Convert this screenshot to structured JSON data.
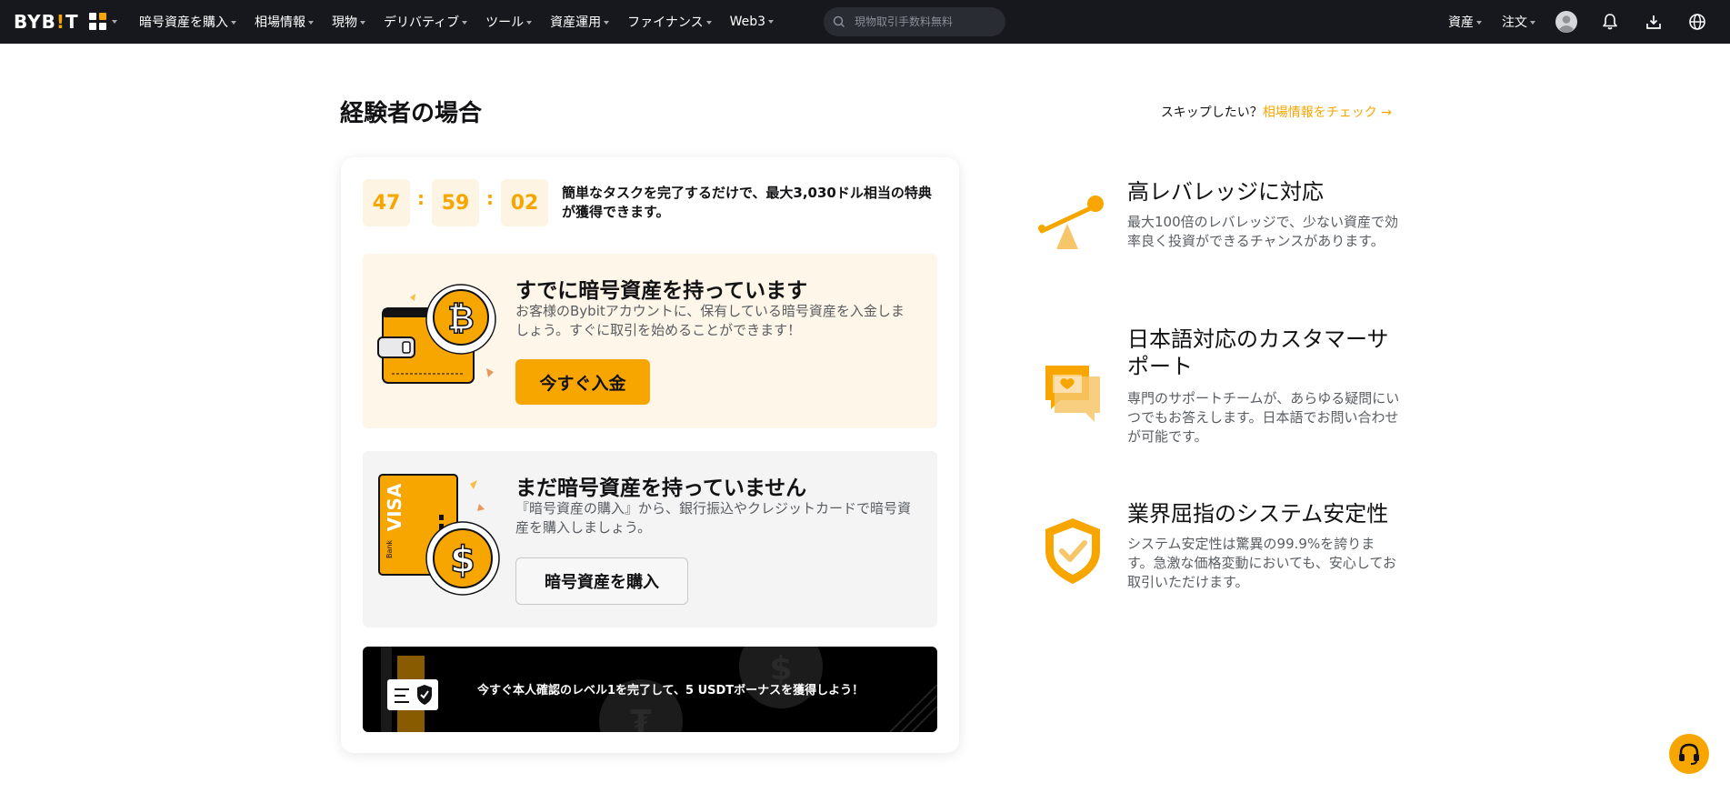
{
  "nav": {
    "logo_main": "BYB",
    "logo_bang": "!",
    "logo_end": "T",
    "items": [
      {
        "label": "暗号資産を購入"
      },
      {
        "label": "相場情報"
      },
      {
        "label": "現物"
      },
      {
        "label": "デリバティブ"
      },
      {
        "label": "ツール"
      },
      {
        "label": "資産運用"
      },
      {
        "label": "ファイナンス"
      },
      {
        "label": "Web3"
      }
    ],
    "search_placeholder": "現物取引手数料無料",
    "right_items": [
      {
        "label": "資産"
      },
      {
        "label": "注文"
      }
    ]
  },
  "page": {
    "title": "経験者の場合",
    "skip_text": "スキップしたい？",
    "skip_link": "相場情報をチェック →"
  },
  "timer": {
    "hours": "47",
    "minutes": "59",
    "seconds": "02",
    "sep": ":",
    "text": "簡単なタスクを完了するだけで、最大3,030ドル相当の特典が獲得できます。"
  },
  "panels": {
    "have_crypto": {
      "title": "すでに暗号資産を持っています",
      "desc": "お客様のBybitアカウントに、保有している暗号資産を入金しましょう。すぐに取引を始めることができます！",
      "button": "今すぐ入金"
    },
    "no_crypto": {
      "title": "まだ暗号資産を持っていません",
      "desc": "『暗号資産の購入』から、銀行振込やクレジットカードで暗号資産を購入しましょう。",
      "button": "暗号資産を購入",
      "card_brand": "VISA",
      "card_bank": "Bank"
    }
  },
  "banner": {
    "text": "今すぐ本人確認のレベル1を完了して、5 USDTボーナスを獲得しよう！"
  },
  "features": [
    {
      "title": "高レバレッジに対応",
      "desc": "最大100倍のレバレッジで、少ない資産で効率良く投資ができるチャンスがあります。",
      "icon": "seesaw-icon"
    },
    {
      "title": "日本語対応のカスタマーサポート",
      "desc": "専門のサポートチームが、あらゆる疑問にいつでもお答えします。日本語でお問い合わせが可能です。",
      "icon": "chat-bubbles-icon"
    },
    {
      "title": "業界屈指のシステム安定性",
      "desc": "システム安定性は驚異の99.9%を誇ります。急激な価格変動においても、安心してお取引いただけます。",
      "icon": "shield-check-icon"
    }
  ],
  "colors": {
    "accent": "#f7a600",
    "nav_bg": "#17181e",
    "panel_warm": "#fef6e8",
    "panel_gray": "#f4f4f5"
  }
}
